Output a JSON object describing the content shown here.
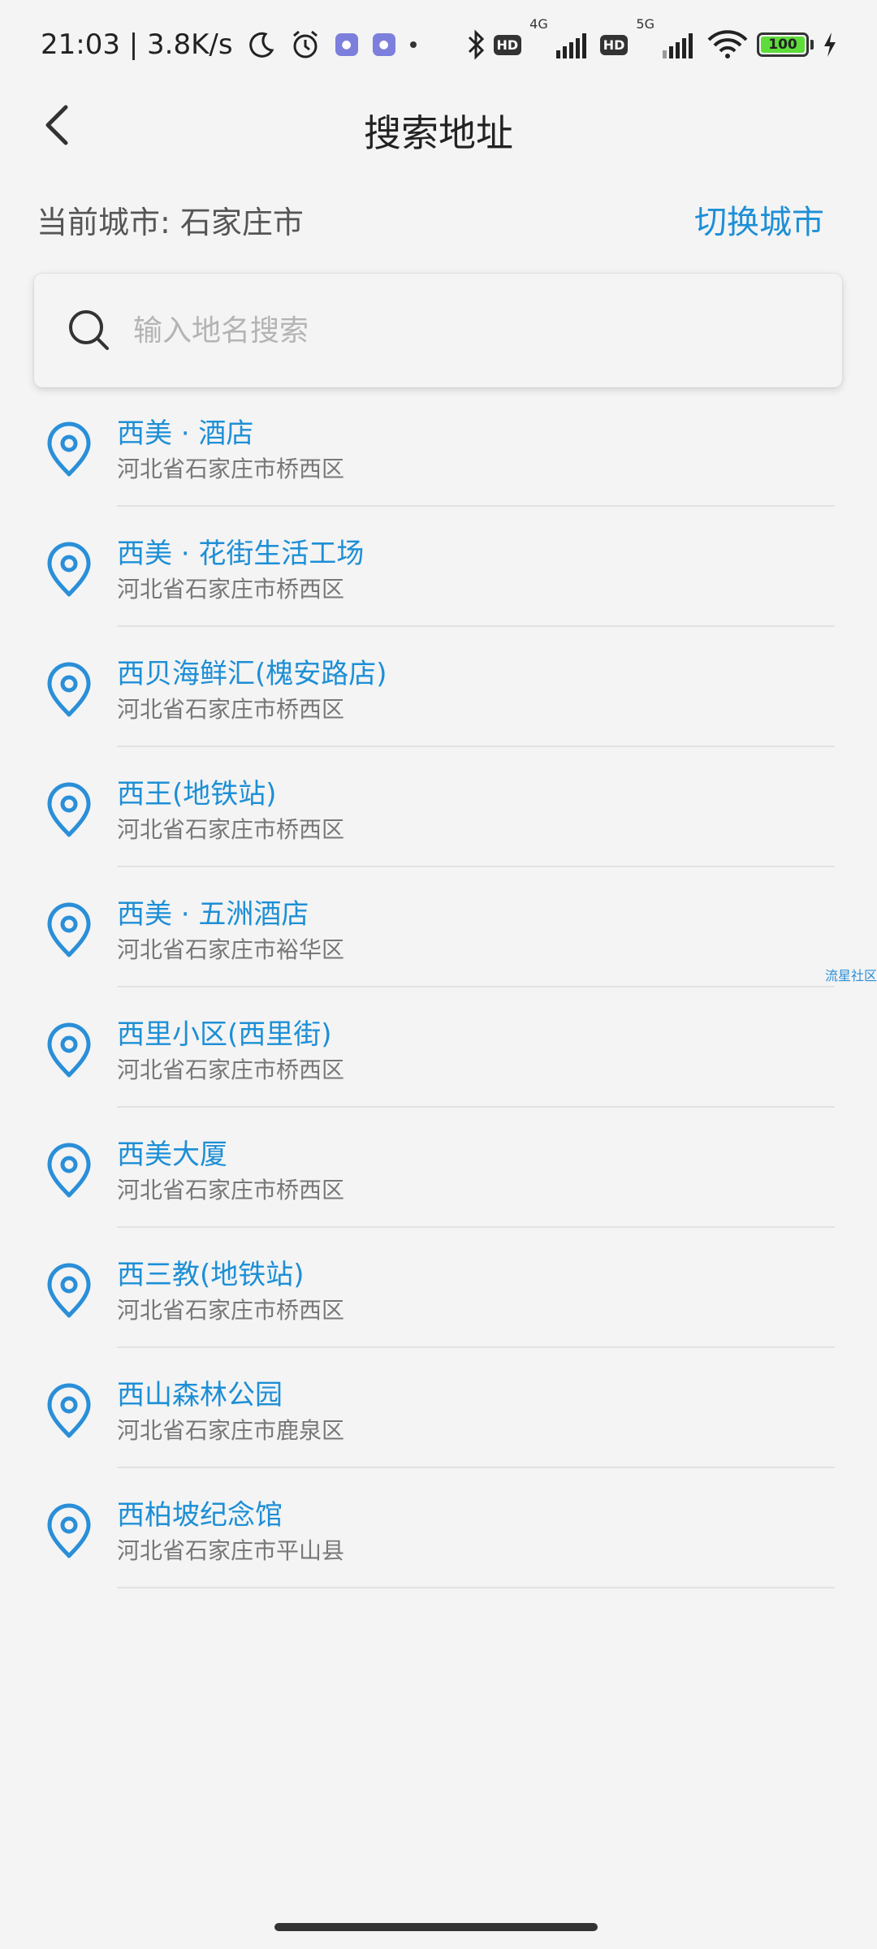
{
  "status_bar": {
    "time_speed": "21:03 | 3.8K/s",
    "hd1": "HD",
    "net1": "4G",
    "hd2": "HD",
    "net2": "5G",
    "battery": "100",
    "icons": [
      "moon-icon",
      "alarm-icon",
      "notification-app-icon",
      "notification-app-icon",
      "bluetooth-icon",
      "signal-icon",
      "wifi-icon",
      "battery-icon",
      "charging-icon"
    ],
    "battery_color": "#5ddc3a"
  },
  "header": {
    "title": "搜索地址"
  },
  "city": {
    "current": "当前城市: 石家庄市",
    "switch_label": "切换城市"
  },
  "search": {
    "placeholder": "输入地名搜索",
    "value": ""
  },
  "results": [
    {
      "name": "西美 · 酒店",
      "address": "河北省石家庄市桥西区"
    },
    {
      "name": "西美 · 花街生活工场",
      "address": "河北省石家庄市桥西区"
    },
    {
      "name": "西贝海鲜汇(槐安路店)",
      "address": "河北省石家庄市桥西区"
    },
    {
      "name": "西王(地铁站)",
      "address": "河北省石家庄市桥西区"
    },
    {
      "name": "西美 · 五洲酒店",
      "address": "河北省石家庄市裕华区"
    },
    {
      "name": "西里小区(西里街)",
      "address": "河北省石家庄市桥西区"
    },
    {
      "name": "西美大厦",
      "address": "河北省石家庄市桥西区"
    },
    {
      "name": "西三教(地铁站)",
      "address": "河北省石家庄市桥西区"
    },
    {
      "name": "西山森林公园",
      "address": "河北省石家庄市鹿泉区"
    },
    {
      "name": "西柏坡纪念馆",
      "address": "河北省石家庄市平山县"
    }
  ],
  "watermark": "流星社区",
  "colors": {
    "accent": "#1d8fd6",
    "background": "#f4f4f4"
  }
}
